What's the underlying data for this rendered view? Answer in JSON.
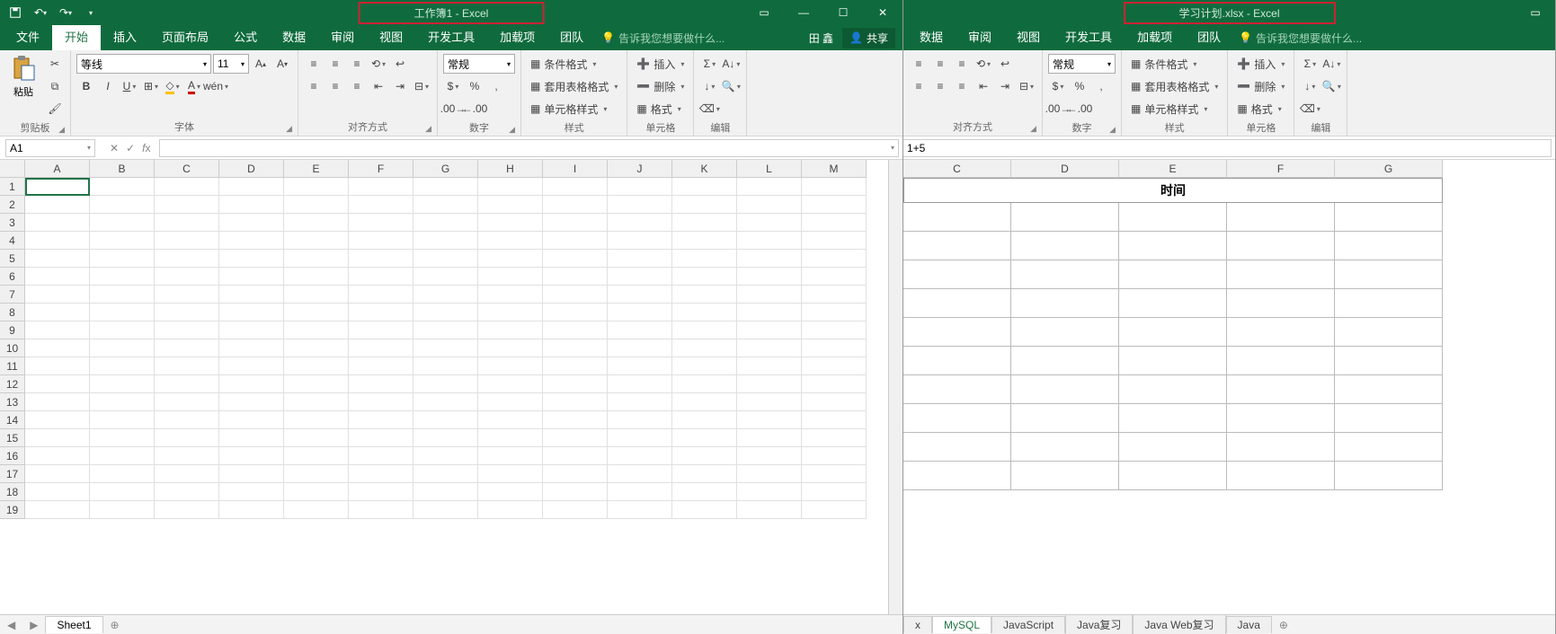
{
  "left": {
    "title": "工作簿1 - Excel",
    "tabs": [
      "文件",
      "开始",
      "插入",
      "页面布局",
      "公式",
      "数据",
      "审阅",
      "视图",
      "开发工具",
      "加载项",
      "团队"
    ],
    "active_tab": "开始",
    "tell_me": "告诉我您想要做什么...",
    "user": "田 鑫",
    "share": "共享",
    "name_box": "A1",
    "formula": "",
    "font_name": "等线",
    "font_size": "11",
    "number_format": "常规",
    "groups": {
      "clipboard": "剪贴板",
      "paste": "粘贴",
      "font": "字体",
      "align": "对齐方式",
      "number": "数字",
      "styles": "样式",
      "cond_fmt": "条件格式",
      "table_fmt": "套用表格格式",
      "cell_styles": "单元格样式",
      "cells": "单元格",
      "insert": "插入",
      "delete": "删除",
      "format": "格式",
      "editing": "编辑"
    },
    "columns": [
      "A",
      "B",
      "C",
      "D",
      "E",
      "F",
      "G",
      "H",
      "I",
      "J",
      "K",
      "L",
      "M"
    ],
    "rows": 19,
    "sheet_tabs": [
      "Sheet1"
    ]
  },
  "right": {
    "title": "学习计划.xlsx - Excel",
    "tabs": [
      "数据",
      "审阅",
      "视图",
      "开发工具",
      "加载项",
      "团队"
    ],
    "tell_me": "告诉我您想要做什么...",
    "number_format": "常规",
    "groups": {
      "align": "对齐方式",
      "number": "数字",
      "styles": "样式",
      "cond_fmt": "条件格式",
      "table_fmt": "套用表格格式",
      "cell_styles": "单元格样式",
      "cells": "单元格",
      "insert": "插入",
      "delete": "删除",
      "format": "格式",
      "editing": "编辑"
    },
    "formula": "1+5",
    "columns": [
      "C",
      "D",
      "E",
      "F",
      "G"
    ],
    "merged_header": "时间",
    "rows": 10,
    "sheet_tabs": [
      "x",
      "MySQL",
      "JavaScript",
      "Java复习",
      "Java Web复习",
      "Java"
    ]
  }
}
